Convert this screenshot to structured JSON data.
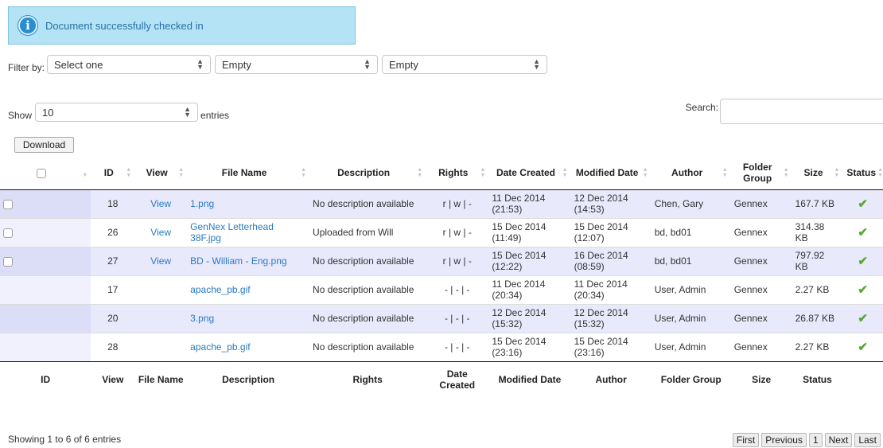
{
  "alert": {
    "icon": "info-icon",
    "message": "Document successfully checked in"
  },
  "filter": {
    "label": "Filter by:",
    "selects": [
      {
        "value": "Select one"
      },
      {
        "value": "Empty"
      },
      {
        "value": "Empty"
      }
    ]
  },
  "length": {
    "show_label": "Show",
    "value": "10",
    "entries_label": "entries"
  },
  "search": {
    "label": "Search:",
    "value": ""
  },
  "download_label": "Download",
  "table": {
    "headers": [
      "ID",
      "View",
      "File Name",
      "Description",
      "Rights",
      "Date Created",
      "Modified Date",
      "Author",
      "Folder Group",
      "Size",
      "Status"
    ],
    "footers": [
      "ID",
      "View",
      "File Name",
      "Description",
      "Rights",
      "Date Created",
      "Modified Date",
      "Author",
      "Folder Group",
      "Size",
      "Status"
    ],
    "rows": [
      {
        "checkbox": true,
        "id": "18",
        "view": "View",
        "file": "1.png",
        "desc": "No description available",
        "rights": "r | w | -",
        "created": "11 Dec 2014 (21:53)",
        "modified": "12 Dec 2014 (14:53)",
        "author": "Chen, Gary",
        "group": "Gennex",
        "size": "167.7 KB",
        "status": "✔"
      },
      {
        "checkbox": true,
        "id": "26",
        "view": "View",
        "file": "GenNex Letterhead 38F.jpg",
        "desc": "Uploaded from Will",
        "rights": "r | w | -",
        "created": "15 Dec 2014 (11:49)",
        "modified": "15 Dec 2014 (12:07)",
        "author": "bd, bd01",
        "group": "Gennex",
        "size": "314.38 KB",
        "status": "✔"
      },
      {
        "checkbox": true,
        "id": "27",
        "view": "View",
        "file": "BD - William - Eng.png",
        "desc": "No description available",
        "rights": "r | w | -",
        "created": "15 Dec 2014 (12:22)",
        "modified": "16 Dec 2014 (08:59)",
        "author": "bd, bd01",
        "group": "Gennex",
        "size": "797.92 KB",
        "status": "✔"
      },
      {
        "checkbox": false,
        "id": "17",
        "view": "",
        "file": "apache_pb.gif",
        "desc": "No description available",
        "rights": "- | - | -",
        "created": "11 Dec 2014 (20:34)",
        "modified": "11 Dec 2014 (20:34)",
        "author": "User, Admin",
        "group": "Gennex",
        "size": "2.27 KB",
        "status": "✔"
      },
      {
        "checkbox": false,
        "id": "20",
        "view": "",
        "file": "3.png",
        "desc": "No description available",
        "rights": "- | - | -",
        "created": "12 Dec 2014 (15:32)",
        "modified": "12 Dec 2014 (15:32)",
        "author": "User, Admin",
        "group": "Gennex",
        "size": "26.87 KB",
        "status": "✔"
      },
      {
        "checkbox": false,
        "id": "28",
        "view": "",
        "file": "apache_pb.gif",
        "desc": "No description available",
        "rights": "- | - | -",
        "created": "15 Dec 2014 (23:16)",
        "modified": "15 Dec 2014 (23:16)",
        "author": "User, Admin",
        "group": "Gennex",
        "size": "2.27 KB",
        "status": "✔"
      }
    ]
  },
  "info": "Showing 1 to 6 of 6 entries",
  "pager": [
    "First",
    "Previous",
    "1",
    "Next",
    "Last"
  ],
  "colors": {
    "alert_bg": "#b3e3f5",
    "link": "#2a7bc4",
    "odd_row": "#e8e9fb",
    "status_ok": "#5aa832"
  }
}
